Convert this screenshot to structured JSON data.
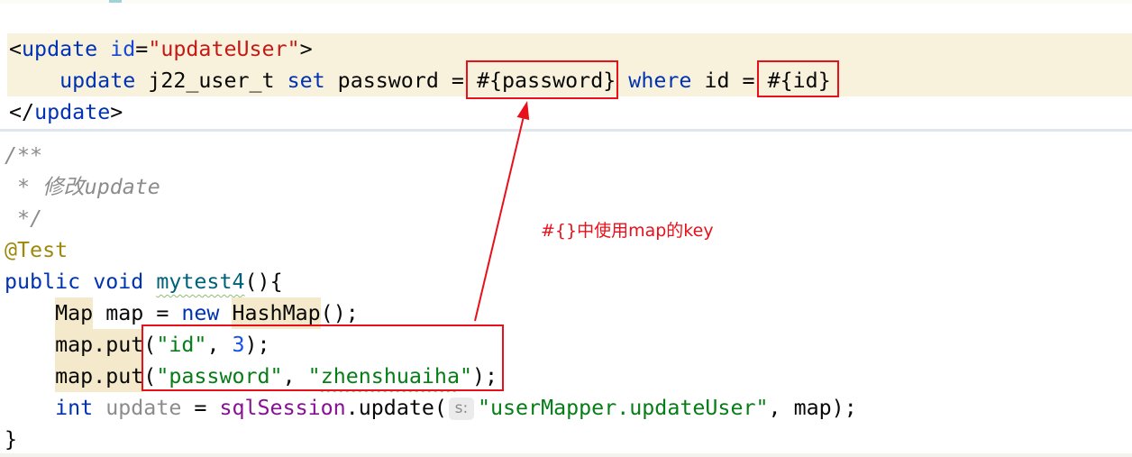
{
  "palette": {
    "plain": "#080808",
    "tag": "#0033b3",
    "attr": "#174ad4",
    "attr_value": "#c41a16",
    "keyword": "#0033b3",
    "param": "#080808",
    "comment": "#8c8c8c",
    "annotation": "#9e880d",
    "method": "#00627a",
    "string": "#067d17",
    "number": "#1750eb",
    "field": "#871094",
    "unused": "#8c8c8c",
    "hint": "#8c8c8c",
    "hint_bg": "#ebebeb",
    "warning_bg": "#f4e9cb",
    "band_bg": "#f8f1dc",
    "typo_underline": "#8cbf72",
    "annotation_red": "#e8101a",
    "separator": "#dfe6ee",
    "caret_marker": "#9fd3d6"
  },
  "editor": {
    "xml": {
      "lines": [
        {
          "highlighted": true,
          "tokens": [
            {
              "plain": "<"
            },
            {
              "tag": "update"
            },
            {
              "plain": " "
            },
            {
              "attr": "id"
            },
            {
              "plain": "="
            },
            {
              "attr_value": "\"updateUser\""
            },
            {
              "plain": ">"
            }
          ]
        },
        {
          "highlighted": true,
          "tokens": [
            {
              "plain": "    "
            },
            {
              "keyword": "update"
            },
            {
              "plain": " j22_user_t "
            },
            {
              "keyword": "set"
            },
            {
              "plain": " password = "
            },
            {
              "param": "#{password}"
            },
            {
              "plain": " "
            },
            {
              "keyword": "where"
            },
            {
              "plain": " id = "
            },
            {
              "param": "#{id}"
            }
          ]
        },
        {
          "highlighted": false,
          "tokens": [
            {
              "plain": "</"
            },
            {
              "tag": "update"
            },
            {
              "plain": ">"
            }
          ]
        }
      ]
    },
    "java": {
      "lines": [
        {
          "tokens": [
            {
              "comment": "/**"
            }
          ]
        },
        {
          "tokens": [
            {
              "comment": " * 修改update"
            }
          ]
        },
        {
          "tokens": [
            {
              "comment": " */"
            }
          ]
        },
        {
          "tokens": [
            {
              "annotation": "@Test"
            }
          ]
        },
        {
          "tokens": [
            {
              "keyword": "public"
            },
            {
              "plain": " "
            },
            {
              "keyword": "void"
            },
            {
              "plain": " "
            },
            {
              "method": "mytest4",
              "typo": true
            },
            {
              "plain": "(){"
            }
          ]
        },
        {
          "tokens": [
            {
              "plain": "    "
            },
            {
              "plain": "Map",
              "warn": true
            },
            {
              "plain": " map = "
            },
            {
              "keyword": "new"
            },
            {
              "plain": " "
            },
            {
              "plain": "HashMap",
              "warn": true
            },
            {
              "plain": "();"
            }
          ]
        },
        {
          "tokens": [
            {
              "plain": "    "
            },
            {
              "plain": "map.put",
              "warn": true
            },
            {
              "plain": "("
            },
            {
              "string": "\"id\""
            },
            {
              "plain": ", "
            },
            {
              "number": "3"
            },
            {
              "plain": ");"
            }
          ]
        },
        {
          "tokens": [
            {
              "plain": "    "
            },
            {
              "plain": "map.put",
              "warn": true
            },
            {
              "plain": "("
            },
            {
              "string": "\"password\""
            },
            {
              "plain": ", "
            },
            {
              "string": "\""
            },
            {
              "string": "zhenshuaiha",
              "typo": true
            },
            {
              "string": "\""
            },
            {
              "plain": ");"
            }
          ]
        },
        {
          "tokens": [
            {
              "plain": "    "
            },
            {
              "keyword": "int"
            },
            {
              "plain": " "
            },
            {
              "unused": "update"
            },
            {
              "plain": " = "
            },
            {
              "field": "sqlSession"
            },
            {
              "plain": ".update("
            },
            {
              "hint": "s:"
            },
            {
              "string": "\"userMapper.updateUser\""
            },
            {
              "plain": ", map);"
            }
          ]
        },
        {
          "tokens": [
            {
              "plain": "}"
            }
          ]
        }
      ]
    }
  },
  "annotation": {
    "label": "#{}中使用map的key"
  }
}
